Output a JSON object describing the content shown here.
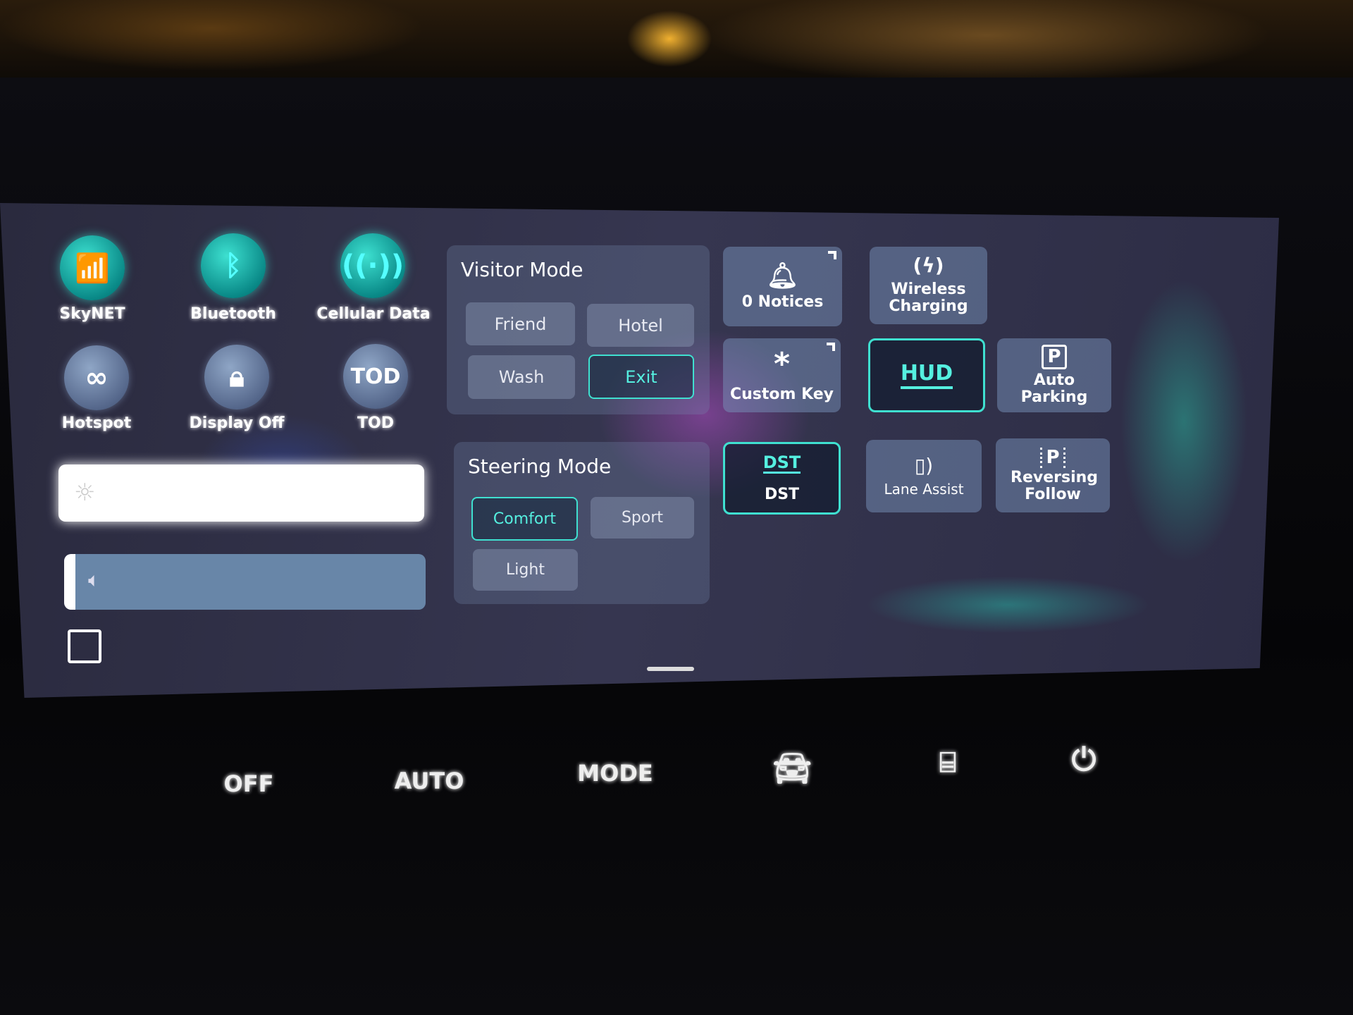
{
  "quick_toggles": [
    {
      "label": "SkyNET",
      "icon": "wifi-icon",
      "active": true
    },
    {
      "label": "Bluetooth",
      "icon": "bluetooth-icon",
      "active": true
    },
    {
      "label": "Cellular Data",
      "icon": "cellular-antenna-icon",
      "active": true
    },
    {
      "label": "Hotspot",
      "icon": "hotspot-link-icon",
      "active": false
    },
    {
      "label": "Display Off",
      "icon": "lock-icon",
      "active": false
    },
    {
      "label": "TOD",
      "icon": "tod-icon",
      "icon_text": "TOD",
      "active": false
    }
  ],
  "sliders": {
    "brightness": {
      "icon": "sun-icon",
      "level_percent": 100
    },
    "volume": {
      "icon": "speaker-icon",
      "level_percent": 3
    }
  },
  "edit": {
    "icon": "edit-icon"
  },
  "visitor_mode": {
    "title": "Visitor Mode",
    "options": [
      "Friend",
      "Hotel",
      "Wash",
      "Exit"
    ],
    "selected": "Exit"
  },
  "steering_mode": {
    "title": "Steering Mode",
    "options": [
      "Comfort",
      "Sport",
      "Light"
    ],
    "selected": "Comfort"
  },
  "tiles": [
    {
      "label": "0 Notices",
      "icon": "bell-icon",
      "active": false
    },
    {
      "label": "Wireless Charging",
      "icon": "wireless-charging-icon",
      "active": false
    },
    {
      "label": "Custom Key",
      "icon": "asterisk-icon",
      "active": false
    },
    {
      "label": "HUD",
      "icon_text": "HUD",
      "icon": "hud-icon",
      "active": true
    },
    {
      "label": "Auto Parking",
      "icon": "parking-icon",
      "icon_text": "P",
      "active": false
    },
    {
      "label": "DST",
      "icon_text": "DST",
      "icon": "dst-icon",
      "active": true
    },
    {
      "label": "Lane Assist",
      "icon": "lane-assist-icon",
      "active": false
    },
    {
      "label": "Reversing Follow",
      "icon": "reversing-follow-icon",
      "icon_text": "P",
      "active": false
    }
  ],
  "physical_buttons": [
    "OFF",
    "AUTO",
    "MODE"
  ],
  "physical_icons": [
    "car-icon",
    "rear-defrost-icon",
    "power-icon"
  ],
  "colors": {
    "accent": "#3fe0d0"
  }
}
